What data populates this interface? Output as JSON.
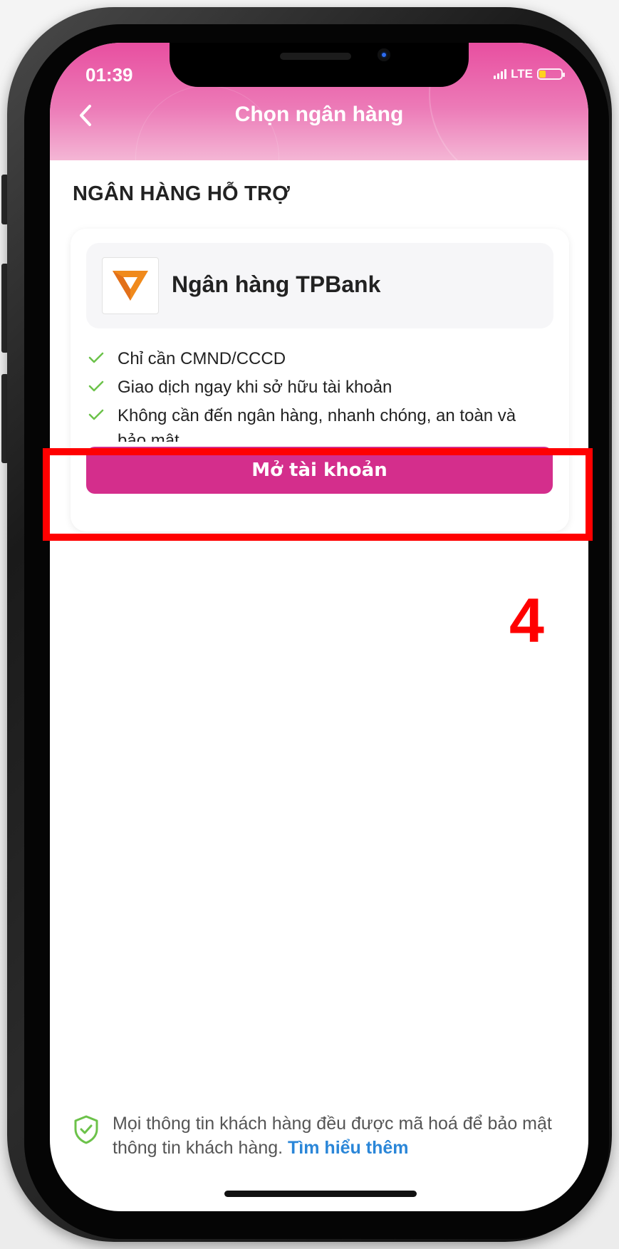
{
  "status_bar": {
    "time": "01:39",
    "network": "LTE",
    "battery_level": 0.3
  },
  "header": {
    "back_icon": "chevron-left-icon",
    "title": "Chọn ngân hàng"
  },
  "section": {
    "title": "NGÂN HÀNG HỖ TRỢ"
  },
  "bank": {
    "logo_icon": "tpbank-logo",
    "name": "Ngân hàng TPBank",
    "features": [
      "Chỉ cần CMND/CCCD",
      "Giao dịch ngay khi sở hữu tài khoản",
      "Không cần đến ngân hàng, nhanh chóng, an toàn và bảo mật"
    ],
    "open_button_label": "Mở tài khoản"
  },
  "annotation": {
    "step_number": "4",
    "color": "#ff0000"
  },
  "security_note": {
    "icon": "shield-check-icon",
    "text": "Mọi thông tin khách hàng đều được mã hoá để bảo mật thông tin khách hàng. ",
    "link": "Tìm hiểu thêm"
  },
  "colors": {
    "brand_pink": "#d42e8c",
    "header_pink": "#e84fa0",
    "check_green": "#6cc24a",
    "link_blue": "#2a86d8"
  }
}
